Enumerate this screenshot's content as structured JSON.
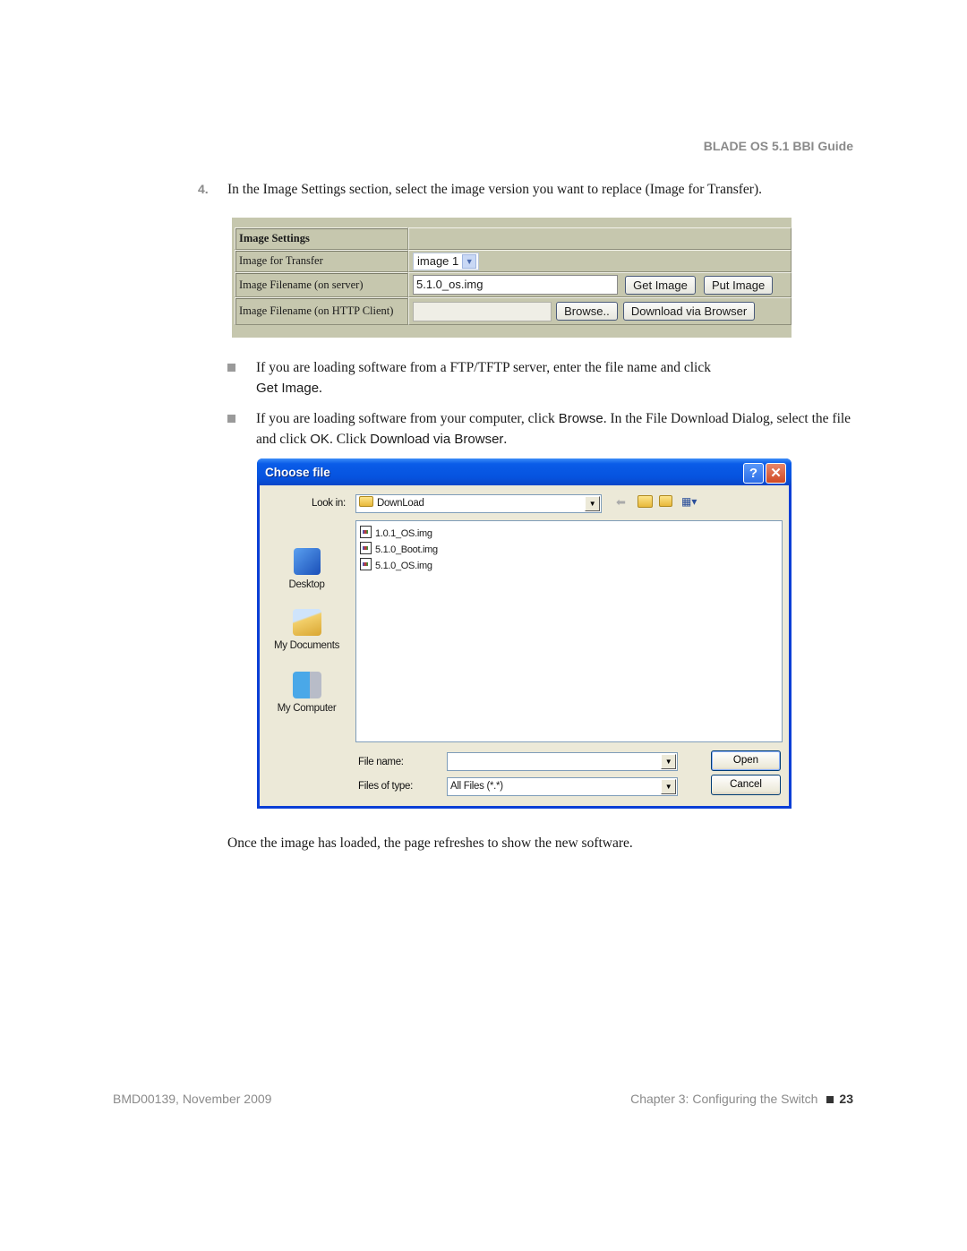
{
  "header": {
    "guide_title": "BLADE OS 5.1 BBI Guide"
  },
  "step": {
    "number": "4.",
    "text": "In the Image Settings section, select the image version you want to replace (Image for Transfer)."
  },
  "image_settings": {
    "heading": "Image Settings",
    "rows": [
      {
        "label": "Image for Transfer",
        "select_value": "image 1"
      },
      {
        "label": "Image Filename (on server)",
        "input_value": "5.1.0_os.img",
        "buttons": [
          "Get Image",
          "Put Image"
        ]
      },
      {
        "label": "Image Filename (on HTTP Client)",
        "input_value": "",
        "buttons": [
          "Browse..",
          "Download via Browser"
        ]
      }
    ]
  },
  "bullets": [
    {
      "text": "If you are loading software from a FTP/TFTP server, enter the file name and click",
      "term": "Get Image",
      "tail": "."
    },
    {
      "text_a": "If you are loading software from your computer, click",
      "term_a": "Browse",
      "text_b": ". In the File Download Dialog, select the file and click",
      "term_b": "OK",
      "text_c": ". Click",
      "term_c": "Download via Browser",
      "tail": "."
    }
  ],
  "dialog": {
    "title": "Choose file",
    "help_label": "?",
    "close_label": "✕",
    "look_in_label": "Look in:",
    "look_in_value": "DownLoad",
    "toolbar_icons": [
      "back-icon",
      "up-folder-icon",
      "new-folder-icon",
      "view-menu-icon"
    ],
    "places": [
      {
        "label": "Desktop",
        "icon": "desktop-icon"
      },
      {
        "label": "My Documents",
        "icon": "my-documents-icon"
      },
      {
        "label": "My Computer",
        "icon": "my-computer-icon"
      }
    ],
    "files": [
      "1.0.1_OS.img",
      "5.1.0_Boot.img",
      "5.1.0_OS.img"
    ],
    "file_name_label": "File name:",
    "file_name_value": "",
    "files_of_type_label": "Files of type:",
    "files_of_type_value": "All Files (*.*)",
    "open_label": "Open",
    "cancel_label": "Cancel"
  },
  "closing_text": "Once the image has loaded, the page refreshes to show the new software.",
  "footer": {
    "doc_id": "BMD00139, November 2009",
    "chapter": "Chapter 3: Configuring the Switch",
    "page": "23"
  }
}
